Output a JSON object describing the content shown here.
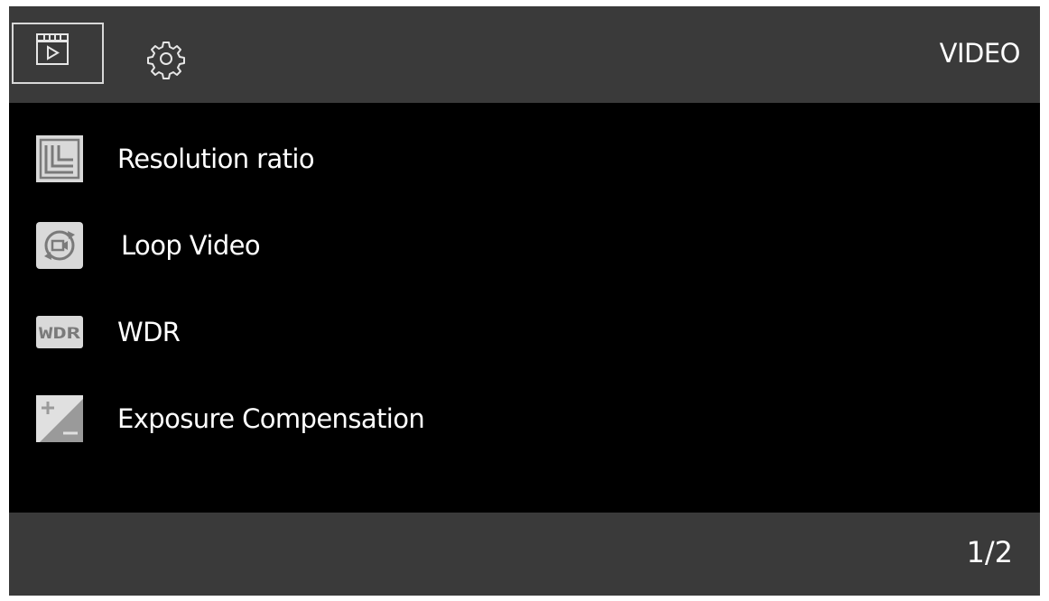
{
  "header": {
    "tabs": [
      {
        "icon": "video-icon",
        "selected": true
      },
      {
        "icon": "gear-icon",
        "selected": false
      }
    ],
    "mode_title": "VIDEO"
  },
  "menu": {
    "items": [
      {
        "label": "Resolution ratio",
        "icon": "resolution-icon"
      },
      {
        "label": "Loop Video",
        "icon": "loop-video-icon"
      },
      {
        "label": "WDR",
        "icon": "wdr-icon",
        "icon_text": "WDR"
      },
      {
        "label": "Exposure Compensation",
        "icon": "exposure-compensation-icon"
      }
    ]
  },
  "footer": {
    "page_indicator": "1/2"
  },
  "colors": {
    "bar_background": "#3a3a3a",
    "content_background": "#000000",
    "text": "#ffffff",
    "icon_fill": "#d9d9d9"
  }
}
